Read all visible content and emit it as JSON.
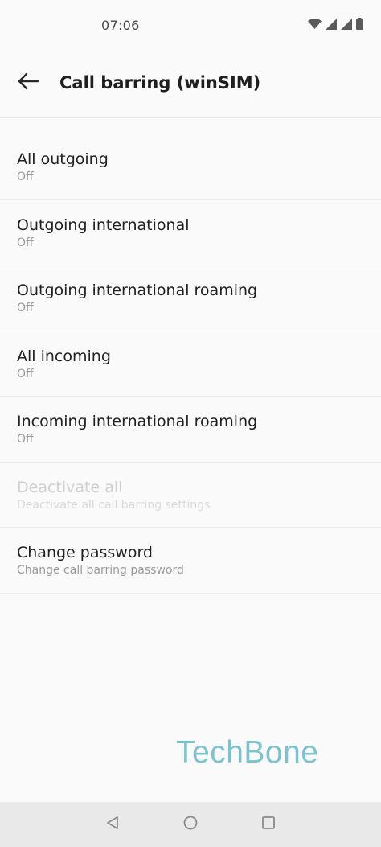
{
  "status_bar": {
    "time": "07:06",
    "icons": [
      "wifi-icon",
      "signal-icon",
      "signal-icon",
      "battery-icon"
    ]
  },
  "app_bar": {
    "back_icon": "arrow-back-icon",
    "title": "Call barring (winSIM)"
  },
  "items": [
    {
      "title": "All outgoing",
      "summary": "Off",
      "enabled": true
    },
    {
      "title": "Outgoing international",
      "summary": "Off",
      "enabled": true
    },
    {
      "title": "Outgoing international roaming",
      "summary": "Off",
      "enabled": true
    },
    {
      "title": "All incoming",
      "summary": "Off",
      "enabled": true
    },
    {
      "title": "Incoming international roaming",
      "summary": "Off",
      "enabled": true
    },
    {
      "title": "Deactivate all",
      "summary": "Deactivate all call barring settings",
      "enabled": false
    },
    {
      "title": "Change password",
      "summary": "Change call barring password",
      "enabled": true
    }
  ],
  "watermark": "TechBone",
  "nav_bar": {
    "icons": [
      "back-triangle-icon",
      "home-circle-icon",
      "recents-square-icon"
    ]
  },
  "colors": {
    "background": "#fafafa",
    "divider": "#ececec",
    "watermark": "#7cc3cf",
    "nav_bar": "#e9e9e9"
  }
}
